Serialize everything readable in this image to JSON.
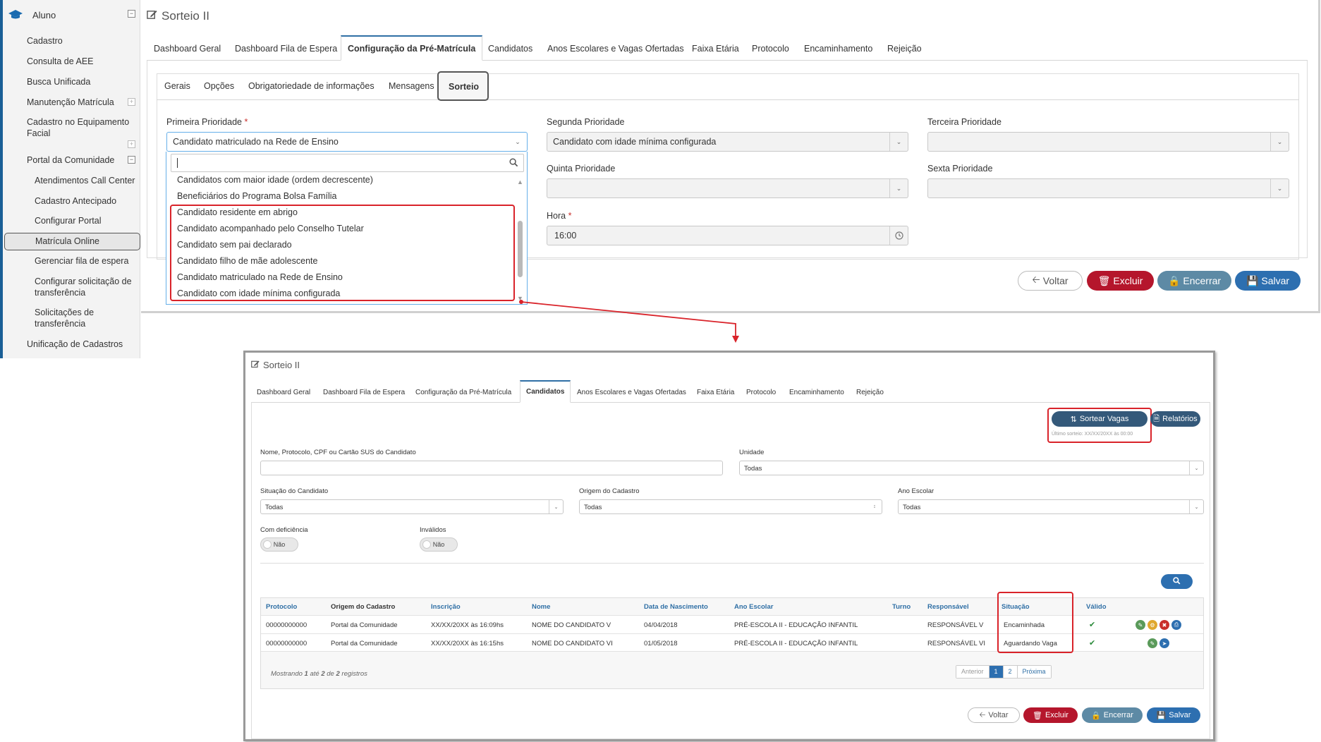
{
  "sidebar": {
    "header": "Aluno",
    "items": [
      {
        "label": "Cadastro"
      },
      {
        "label": "Consulta de AEE"
      },
      {
        "label": "Busca Unificada"
      },
      {
        "label": "Manutenção Matrícula"
      },
      {
        "label": "Cadastro no Equipamento Facial"
      },
      {
        "label": "Portal da Comunidade"
      },
      {
        "label": "Atendimentos Call Center"
      },
      {
        "label": "Cadastro Antecipado"
      },
      {
        "label": "Configurar Portal"
      },
      {
        "label": "Matrícula Online"
      },
      {
        "label": "Gerenciar fila de espera"
      },
      {
        "label": "Configurar solicitação de transferência"
      },
      {
        "label": "Solicitações de transferência"
      },
      {
        "label": "Unificação de Cadastros"
      }
    ]
  },
  "top": {
    "title": "Sorteio II",
    "tabs": [
      "Dashboard Geral",
      "Dashboard Fila de Espera",
      "Configuração da Pré-Matrícula",
      "Candidatos",
      "Anos Escolares e Vagas Ofertadas",
      "Faixa Etária",
      "Protocolo",
      "Encaminhamento",
      "Rejeição"
    ],
    "subtabs": [
      "Gerais",
      "Opções",
      "Obrigatoriedade de informações",
      "Mensagens",
      "Sorteio"
    ],
    "fields": {
      "p1_label": "Primeira Prioridade",
      "p1_value": "Candidato matriculado na Rede de Ensino",
      "p2_label": "Segunda Prioridade",
      "p2_value": "Candidato com idade mínima configurada",
      "p3_label": "Terceira Prioridade",
      "p3_value": "",
      "p5_label": "Quinta Prioridade",
      "p6_label": "Sexta Prioridade",
      "hora_label": "Hora",
      "hora_value": "16:00",
      "required_mark": "*"
    },
    "dropdown": {
      "search_value": "",
      "options": [
        "Candidatos com maior idade (ordem decrescente)",
        "Beneficiários do Programa Bolsa Família",
        "Candidato residente em abrigo",
        "Candidato acompanhado pelo Conselho Tutelar",
        "Candidato sem pai declarado",
        "Candidato filho de mãe adolescente",
        "Candidato matriculado na Rede de Ensino",
        "Candidato com idade mínima configurada"
      ]
    },
    "buttons": {
      "back": "Voltar",
      "delete": "Excluir",
      "close": "Encerrar",
      "save": "Salvar"
    }
  },
  "bottom": {
    "title": "Sorteio II",
    "tabs": [
      "Dashboard Geral",
      "Dashboard Fila de Espera",
      "Configuração da Pré-Matrícula",
      "Candidatos",
      "Anos Escolares e Vagas Ofertadas",
      "Faixa Etária",
      "Protocolo",
      "Encaminhamento",
      "Rejeição"
    ],
    "sortear": "Sortear Vagas",
    "relatorios": "Relatórios",
    "ultimo_sorteio": "Último sorteio: XX/XX/20XX às 00:00",
    "filters": {
      "nome_label": "Nome, Protocolo, CPF ou Cartão SUS do Candidato",
      "nome_value": "",
      "unidade_label": "Unidade",
      "unidade_value": "Todas",
      "situacao_label": "Situação do Candidato",
      "situacao_value": "Todas",
      "origem_label": "Origem do Cadastro",
      "origem_value": "Todas",
      "ano_label": "Ano Escolar",
      "ano_value": "Todas",
      "deficiencia_label": "Com deficiência",
      "deficiencia_value": "Não",
      "invalidos_label": "Inválidos",
      "invalidos_value": "Não"
    },
    "table": {
      "headers": [
        "Protocolo",
        "Origem do Cadastro",
        "Inscrição",
        "Nome",
        "Data de Nascimento",
        "Ano Escolar",
        "Turno",
        "Responsável",
        "Situação",
        "Válido"
      ],
      "rows": [
        [
          "00000000000",
          "Portal da Comunidade",
          "XX/XX/20XX às 16:09hs",
          "NOME DO CANDIDATO V",
          "04/04/2018",
          "PRÉ-ESCOLA II - EDUCAÇÃO INFANTIL",
          "",
          "RESPONSÁVEL V",
          "Encaminhada",
          "✔"
        ],
        [
          "00000000000",
          "Portal da Comunidade",
          "XX/XX/20XX às 16:15hs",
          "NOME DO CANDIDATO VI",
          "01/05/2018",
          "PRÉ-ESCOLA II - EDUCAÇÃO INFANTIL",
          "",
          "RESPONSÁVEL VI",
          "Aguardando Vaga",
          "✔"
        ]
      ],
      "footer": {
        "mostrando": "Mostrando",
        "from": "1",
        "ate": "até",
        "to": "2",
        "de": "de",
        "total": "2",
        "registros": "registros"
      },
      "pager": [
        "Anterior",
        "1",
        "2",
        "Próxima"
      ]
    },
    "buttons": {
      "back": "Voltar",
      "delete": "Excluir",
      "close": "Encerrar",
      "save": "Salvar"
    }
  }
}
